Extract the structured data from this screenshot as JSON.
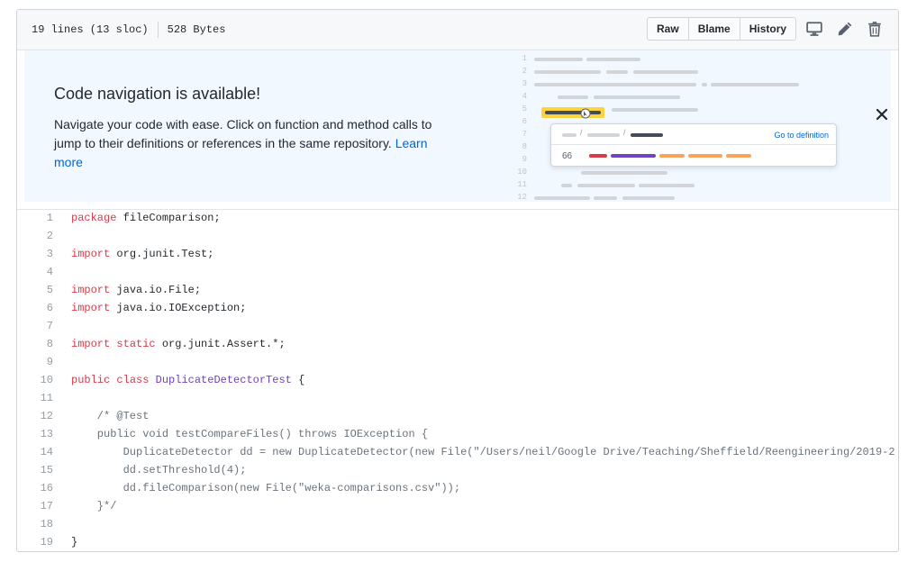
{
  "file_header": {
    "lines_info": "19 lines (13 sloc)",
    "size": "528 Bytes",
    "buttons": {
      "raw": "Raw",
      "blame": "Blame",
      "history": "History"
    }
  },
  "code_nav_banner": {
    "title": "Code navigation is available!",
    "body": "Navigate your code with ease. Click on function and method calls to jump to their definitions or references in the same repository.",
    "learn_more": "Learn more",
    "illustration": {
      "line_numbers": [
        "1",
        "2",
        "3",
        "4",
        "5",
        "6",
        "7",
        "8",
        "9",
        "10",
        "11",
        "12"
      ],
      "go_to_definition": "Go to definition",
      "ref_count": "66"
    }
  },
  "code": {
    "line_numbers": [
      "1",
      "2",
      "3",
      "4",
      "5",
      "6",
      "7",
      "8",
      "9",
      "10",
      "11",
      "12",
      "13",
      "14",
      "15",
      "16",
      "17",
      "18",
      "19"
    ],
    "lines": [
      [
        {
          "t": "package",
          "c": "kw"
        },
        {
          "t": " fileComparison;"
        }
      ],
      [],
      [
        {
          "t": "import",
          "c": "kw"
        },
        {
          "t": " org.junit.Test;"
        }
      ],
      [],
      [
        {
          "t": "import",
          "c": "kw"
        },
        {
          "t": " java.io.File;"
        }
      ],
      [
        {
          "t": "import",
          "c": "kw"
        },
        {
          "t": " java.io.IOException;"
        }
      ],
      [],
      [
        {
          "t": "import",
          "c": "kw"
        },
        {
          "t": " "
        },
        {
          "t": "static",
          "c": "kw"
        },
        {
          "t": " org.junit.Assert.*;"
        }
      ],
      [],
      [
        {
          "t": "public",
          "c": "kw"
        },
        {
          "t": " "
        },
        {
          "t": "class",
          "c": "kw"
        },
        {
          "t": " "
        },
        {
          "t": "DuplicateDetectorTest",
          "c": "cls"
        },
        {
          "t": " {"
        }
      ],
      [],
      [
        {
          "t": "    /* @Test",
          "c": "cm"
        }
      ],
      [
        {
          "t": "    public void testCompareFiles() throws IOException {",
          "c": "cm"
        }
      ],
      [
        {
          "t": "        DuplicateDetector dd = new DuplicateDetector(new File(\"/Users/neil/Google Drive/Teaching/Sheffield/Reengineering/2019-2",
          "c": "cm"
        }
      ],
      [
        {
          "t": "        dd.setThreshold(4);",
          "c": "cm"
        }
      ],
      [
        {
          "t": "        dd.fileComparison(new File(\"weka-comparisons.csv\"));",
          "c": "cm"
        }
      ],
      [
        {
          "t": "    }*/",
          "c": "cm"
        }
      ],
      [],
      [
        {
          "t": "}"
        }
      ]
    ]
  },
  "colors": {
    "keyword": "#d73a49",
    "class_name": "#6f42c1",
    "comment": "#6a737d",
    "link": "#0366d6",
    "banner_bg": "#f1f8ff",
    "highlight": "#ffd33d"
  },
  "icons": [
    "desktop-icon",
    "pencil-icon",
    "trash-icon",
    "close-icon",
    "cursor-icon"
  ]
}
